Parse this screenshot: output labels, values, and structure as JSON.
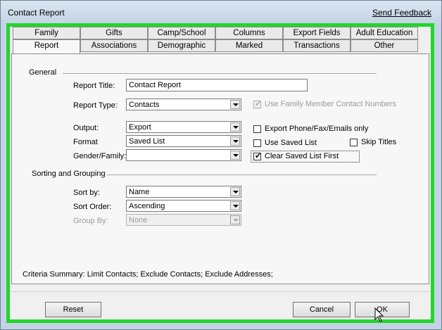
{
  "window": {
    "title": "Contact Report",
    "feedback_link": "Send Feedback"
  },
  "tabs": {
    "row1": [
      "Family",
      "Gifts",
      "Camp/School",
      "Columns",
      "Export Fields",
      "Adult Education"
    ],
    "row2": [
      "Report",
      "Associations",
      "Demographic",
      "Marked",
      "Transactions",
      "Other"
    ],
    "active": "Report"
  },
  "general": {
    "label": "General",
    "report_title_label": "Report Title:",
    "report_title_value": "Contact Report",
    "report_type_label": "Report Type:",
    "report_type_value": "Contacts",
    "use_family_numbers": "Use Family Member Contact Numbers",
    "output_label": "Output:",
    "output_value": "Export",
    "format_label": "Format",
    "format_value": "Saved List",
    "gender_label": "Gender/Family:",
    "gender_value": "",
    "export_phone": "Export Phone/Fax/Emails only",
    "use_saved_list": "Use Saved List",
    "skip_titles": "Skip Titles",
    "clear_saved_list": "Clear Saved List First",
    "checks": {
      "use_family_numbers": true,
      "export_phone": false,
      "use_saved_list": false,
      "skip_titles": false,
      "clear_saved_list": true
    }
  },
  "sorting": {
    "label": "Sorting and Grouping",
    "sort_by_label": "Sort by:",
    "sort_by_value": "Name",
    "sort_order_label": "Sort Order:",
    "sort_order_value": "Ascending",
    "group_by_label": "Group By:",
    "group_by_value": "None"
  },
  "criteria": {
    "label": "Criteria Summary:",
    "value": "Limit Contacts; Exclude Contacts; Exclude Addresses;"
  },
  "buttons": {
    "reset": "Reset",
    "cancel": "Cancel",
    "ok": "OK"
  },
  "colors": {
    "highlight_border": "#22d62a",
    "title_bar": "#c4d4e6"
  }
}
